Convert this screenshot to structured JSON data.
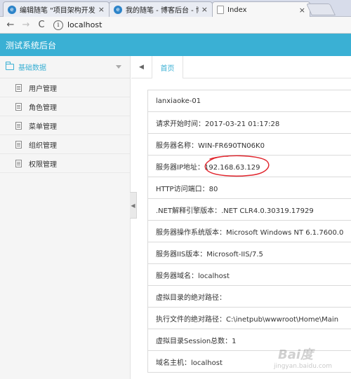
{
  "browser": {
    "tabs": [
      {
        "title": "编辑随笔 \"项目架构开发",
        "icon": "cnblogs-icon",
        "active": false
      },
      {
        "title": "我的随笔 - 博客后台 - 博",
        "icon": "cnblogs-icon",
        "active": false
      },
      {
        "title": "Index",
        "icon": "page-icon",
        "active": true
      }
    ],
    "close_glyph": "×",
    "url": "localhost",
    "nav": {
      "back": "←",
      "forward": "→",
      "reload": "C",
      "info": "i"
    }
  },
  "app": {
    "title": "测试系统后台"
  },
  "sidebar": {
    "group_label": "基础数据",
    "items": [
      {
        "label": "用户管理"
      },
      {
        "label": "角色管理"
      },
      {
        "label": "菜单管理"
      },
      {
        "label": "组织管理"
      },
      {
        "label": "权限管理"
      }
    ]
  },
  "content_tabs": {
    "home_label": "首页",
    "back_glyph": "◀",
    "collapse_glyph": "◀"
  },
  "info_rows": [
    {
      "text": "lanxiaoke-01"
    },
    {
      "text": "请求开始时间：2017-03-21 01:17:28"
    },
    {
      "text": "服务器名称：WIN-FR690TN06K0"
    },
    {
      "text": "服务器IP地址：192.168.63.129"
    },
    {
      "text": "HTTP访问端口：80"
    },
    {
      "text": ".NET解释引擎版本：.NET CLR4.0.30319.17929"
    },
    {
      "text": "服务器操作系统版本：Microsoft Windows NT 6.1.7600.0"
    },
    {
      "text": "服务器IIS版本：Microsoft-IIS/7.5"
    },
    {
      "text": "服务器域名：localhost"
    },
    {
      "text": "虚拟目录的绝对路径："
    },
    {
      "text": "执行文件的绝对路径：C:\\inetpub\\wwwroot\\Home\\Main"
    },
    {
      "text": "虚拟目录Session总数：1"
    },
    {
      "text": "域名主机：localhost"
    }
  ],
  "colors": {
    "accent": "#3ab0d4",
    "annotation": "#e0232b"
  },
  "watermark": {
    "text": "Bai度",
    "sub": "jingyan.baidu.com"
  }
}
